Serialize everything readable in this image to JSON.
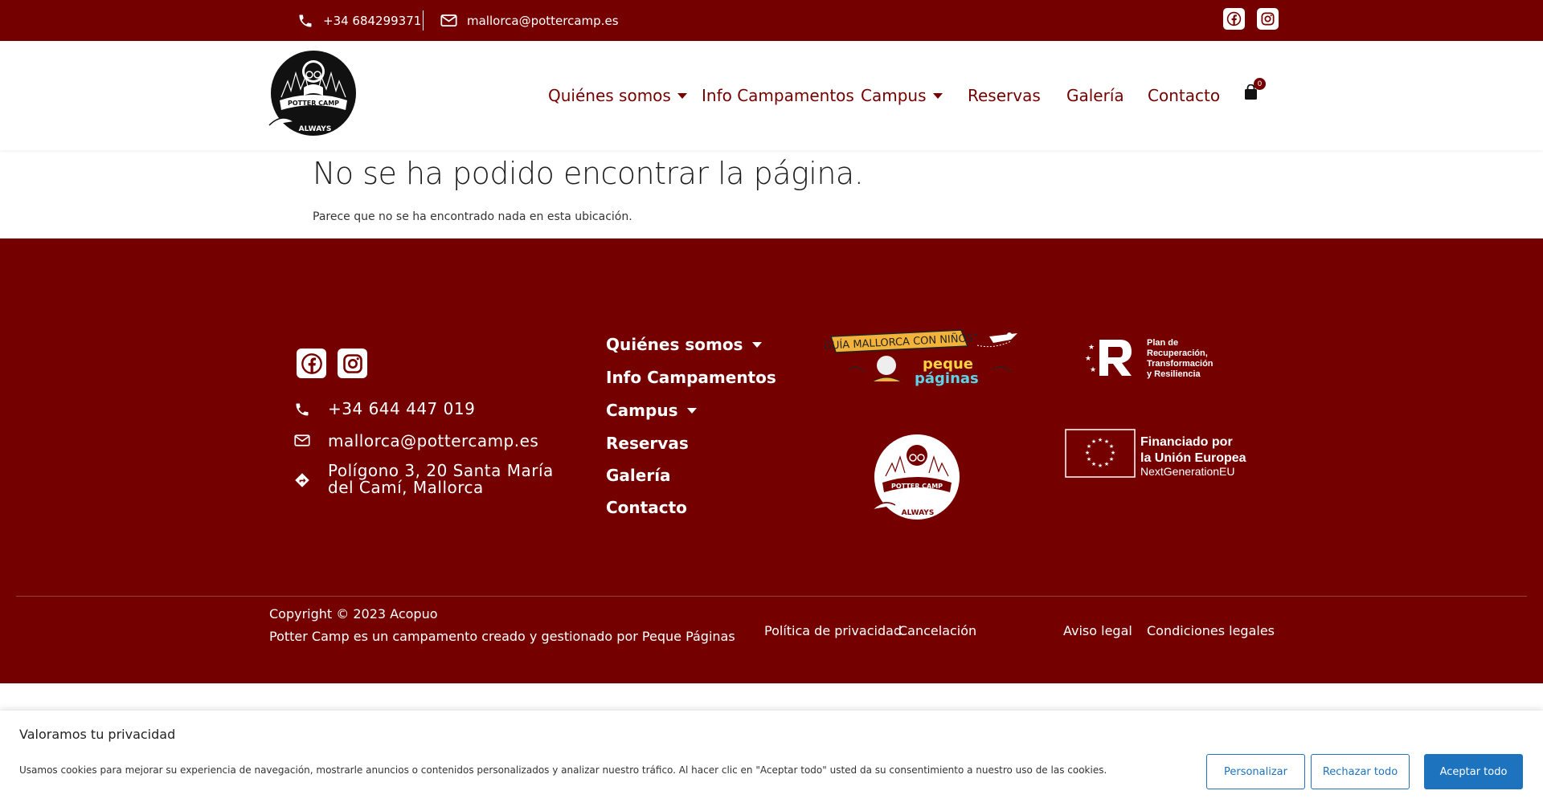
{
  "topbar": {
    "phone": "+34 684299371",
    "email": "mallorca@pottercamp.es",
    "icons": [
      "phone-icon",
      "envelope-icon",
      "facebook-icon",
      "instagram-icon"
    ]
  },
  "logo": {
    "text_top": "POTTER CAMP",
    "text_bottom": "ALWAYS"
  },
  "nav": {
    "items": [
      {
        "label": "Quiénes somos",
        "has_caret": true
      },
      {
        "label": "Info Campamentos",
        "has_caret": false
      },
      {
        "label": "Campus",
        "has_caret": true
      },
      {
        "label": "Reservas",
        "has_caret": false
      },
      {
        "label": "Galería",
        "has_caret": false
      },
      {
        "label": "Contacto",
        "has_caret": false
      }
    ],
    "cart_count": "0"
  },
  "content": {
    "title": "No se ha podido encontrar la página.",
    "text": "Parece que no se ha encontrado nada en esta ubicación."
  },
  "footer": {
    "phone": "+34 644 447 019",
    "email": "mallorca@pottercamp.es",
    "address_line1": "Polígono 3, 20 Santa María",
    "address_line2": "del Camí, Mallorca",
    "nav": [
      "Quiénes somos",
      "Info Campamentos",
      "Campus",
      "Reservas",
      "Galería",
      "Contacto"
    ],
    "guide_badge": "\"GUÍA MALLORCA CON NIÑOS\"",
    "guide_brand_1": "peque",
    "guide_brand_2": "páginas",
    "prtr_lines": [
      "Plan de",
      "Recuperación,",
      "Transformación",
      "y Resiliencia"
    ],
    "eu_line1": "Financiado por",
    "eu_line2": "la Unión Europea",
    "eu_line3": "NextGenerationEU",
    "copyright": "Copyright © 2023 Acopuo",
    "credit": "Potter Camp es un campamento creado y gestionado por Peque Páginas",
    "links": [
      "Política de privacidad",
      "Cancelación",
      "Aviso legal",
      "Condiciones legales"
    ]
  },
  "cookie": {
    "title": "Valoramos tu privacidad",
    "text": "Usamos cookies para mejorar su experiencia de navegación, mostrarle anuncios o contenidos personalizados y analizar nuestro tráfico. Al hacer clic en \"Aceptar todo\" usted da su consentimiento a nuestro uso de las cookies.",
    "btn_customize": "Personalizar",
    "btn_reject": "Rechazar todo",
    "btn_accept": "Aceptar todo"
  },
  "colors": {
    "brand": "#750000",
    "accent": "#1e73be"
  }
}
